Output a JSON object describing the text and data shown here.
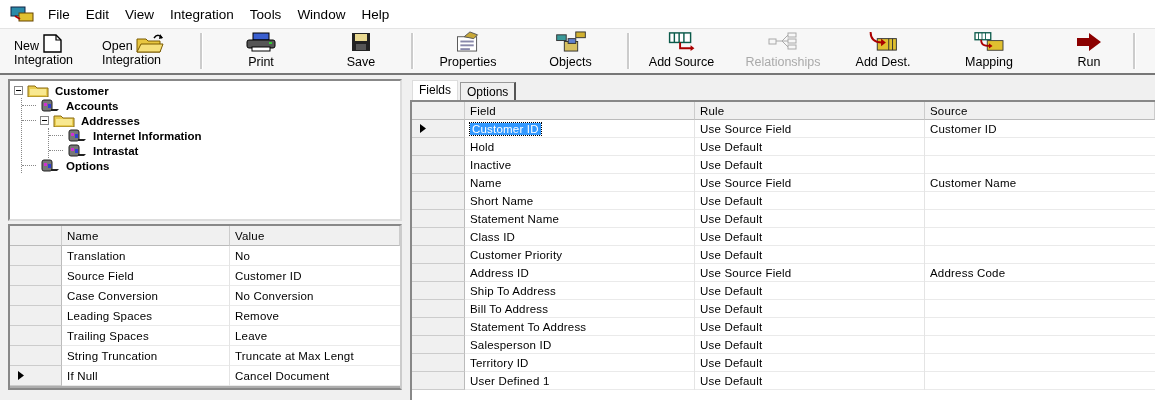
{
  "menu": [
    "File",
    "Edit",
    "View",
    "Integration",
    "Tools",
    "Window",
    "Help"
  ],
  "toolbar": [
    {
      "kind": "inline",
      "lines": [
        "New",
        "Integration"
      ],
      "disabled": false,
      "separator_after": false
    },
    {
      "kind": "inline",
      "lines": [
        "Open",
        "Integration"
      ],
      "disabled": false,
      "separator_after": true
    },
    {
      "kind": "stacked",
      "lines": [
        "Print"
      ],
      "disabled": false,
      "separator_after": false
    },
    {
      "kind": "stacked",
      "lines": [
        "Save"
      ],
      "disabled": false,
      "separator_after": true
    },
    {
      "kind": "stacked",
      "lines": [
        "Properties"
      ],
      "disabled": false,
      "separator_after": false
    },
    {
      "kind": "stacked",
      "lines": [
        "Objects"
      ],
      "disabled": false,
      "separator_after": true
    },
    {
      "kind": "stacked",
      "lines": [
        "Add Source"
      ],
      "disabled": false,
      "separator_after": false
    },
    {
      "kind": "stacked",
      "lines": [
        "Relationships"
      ],
      "disabled": true,
      "separator_after": false
    },
    {
      "kind": "stacked",
      "lines": [
        "Add Dest."
      ],
      "disabled": false,
      "separator_after": false
    },
    {
      "kind": "stacked",
      "lines": [
        "Mapping"
      ],
      "disabled": false,
      "separator_after": false
    },
    {
      "kind": "stacked",
      "lines": [
        "Run"
      ],
      "disabled": false,
      "separator_after": true
    }
  ],
  "tree": [
    {
      "label": "Customer",
      "kind": "folder",
      "expanded": true,
      "children": [
        {
          "label": "Accounts",
          "kind": "table"
        },
        {
          "label": "Addresses",
          "kind": "folder",
          "expanded": true,
          "children": [
            {
              "label": "Internet Information",
              "kind": "table"
            },
            {
              "label": "Intrastat",
              "kind": "table"
            }
          ]
        },
        {
          "label": "Options",
          "kind": "table"
        }
      ]
    }
  ],
  "properties": {
    "columns": [
      "Name",
      "Value"
    ],
    "rows": [
      {
        "cells": [
          "Translation",
          "No"
        ],
        "current": false
      },
      {
        "cells": [
          "Source Field",
          "Customer ID"
        ],
        "current": false
      },
      {
        "cells": [
          "Case Conversion",
          "No Conversion"
        ],
        "current": false
      },
      {
        "cells": [
          "Leading Spaces",
          "Remove"
        ],
        "current": false
      },
      {
        "cells": [
          "Trailing Spaces",
          "Leave"
        ],
        "current": false
      },
      {
        "cells": [
          "String Truncation",
          "Truncate at Max Lengt"
        ],
        "current": false
      },
      {
        "cells": [
          "If Null",
          "Cancel Document"
        ],
        "current": true
      }
    ]
  },
  "tabs": [
    {
      "label": "Fields",
      "selected": true
    },
    {
      "label": "Options",
      "selected": false
    }
  ],
  "fields": {
    "columns": [
      "Field",
      "Rule",
      "Source"
    ],
    "rows": [
      {
        "cells": [
          "Customer ID",
          "Use Source Field",
          "Customer ID"
        ],
        "current": true,
        "selected": true
      },
      {
        "cells": [
          "Hold",
          "Use Default"
        ],
        "current": false,
        "selected": false
      },
      {
        "cells": [
          "Inactive",
          "Use Default"
        ],
        "current": false,
        "selected": false
      },
      {
        "cells": [
          "Name",
          "Use Source Field",
          "Customer Name"
        ],
        "current": false,
        "selected": false
      },
      {
        "cells": [
          "Short Name",
          "Use Default"
        ],
        "current": false,
        "selected": false
      },
      {
        "cells": [
          "Statement Name",
          "Use Default"
        ],
        "current": false,
        "selected": false
      },
      {
        "cells": [
          "Class ID",
          "Use Default"
        ],
        "current": false,
        "selected": false
      },
      {
        "cells": [
          "Customer Priority",
          "Use Default"
        ],
        "current": false,
        "selected": false
      },
      {
        "cells": [
          "Address ID",
          "Use Source Field",
          "Address Code"
        ],
        "current": false,
        "selected": false
      },
      {
        "cells": [
          "Ship To Address",
          "Use Default"
        ],
        "current": false,
        "selected": false
      },
      {
        "cells": [
          "Bill To Address",
          "Use Default"
        ],
        "current": false,
        "selected": false
      },
      {
        "cells": [
          "Statement To Address",
          "Use Default"
        ],
        "current": false,
        "selected": false
      },
      {
        "cells": [
          "Salesperson ID",
          "Use Default"
        ],
        "current": false,
        "selected": false
      },
      {
        "cells": [
          "Territory ID",
          "Use Default"
        ],
        "current": false,
        "selected": false
      },
      {
        "cells": [
          "User Defined 1",
          "Use Default"
        ],
        "current": false,
        "selected": false
      }
    ]
  }
}
